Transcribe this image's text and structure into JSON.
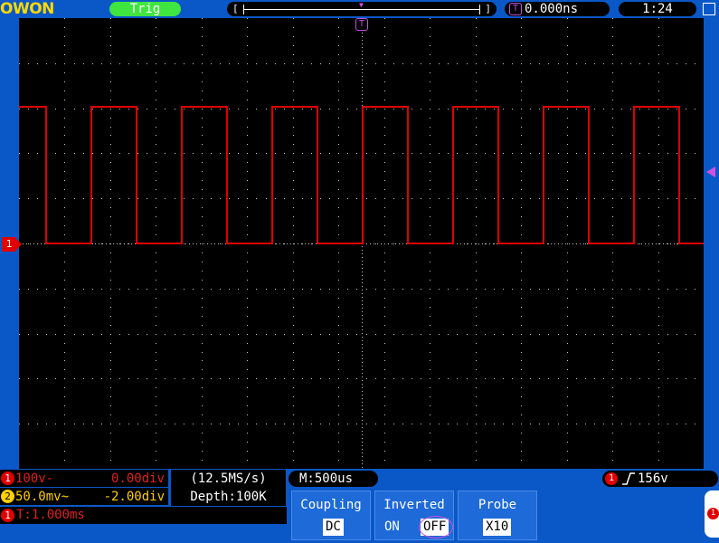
{
  "brand": {
    "logo_text": "OWON"
  },
  "status": {
    "trigger_state": "Trig",
    "trigger_time": "0.000ns",
    "clock": "1:24",
    "trigger_marker_label": "T"
  },
  "channels": [
    {
      "id": "1",
      "scale": "100v-",
      "offset": "0.00div",
      "color": "#e00000"
    },
    {
      "id": "2",
      "scale": "50.0mv~",
      "offset": "-2.00div",
      "color": "#ffd000"
    }
  ],
  "acquisition": {
    "sample_rate": "(12.5MS/s)",
    "depth": "Depth:100K"
  },
  "timebase": {
    "main": "M:500us"
  },
  "trigger": {
    "source": "1",
    "level": "156v",
    "edge": "rising"
  },
  "timer": {
    "channel": "1",
    "text": "T:1.000ms"
  },
  "menu": {
    "coupling": {
      "title": "Coupling",
      "value": "DC"
    },
    "inverted": {
      "title": "Inverted",
      "on": "ON",
      "off": "OFF",
      "selected": "OFF"
    },
    "probe": {
      "title": "Probe",
      "value": "X10"
    }
  },
  "colors": {
    "background": "#0a58c8",
    "screen": "#000000",
    "ch1_trace": "#e00000",
    "trigger_badge": "#3fe640",
    "trigger_marker": "#c050e0"
  }
}
